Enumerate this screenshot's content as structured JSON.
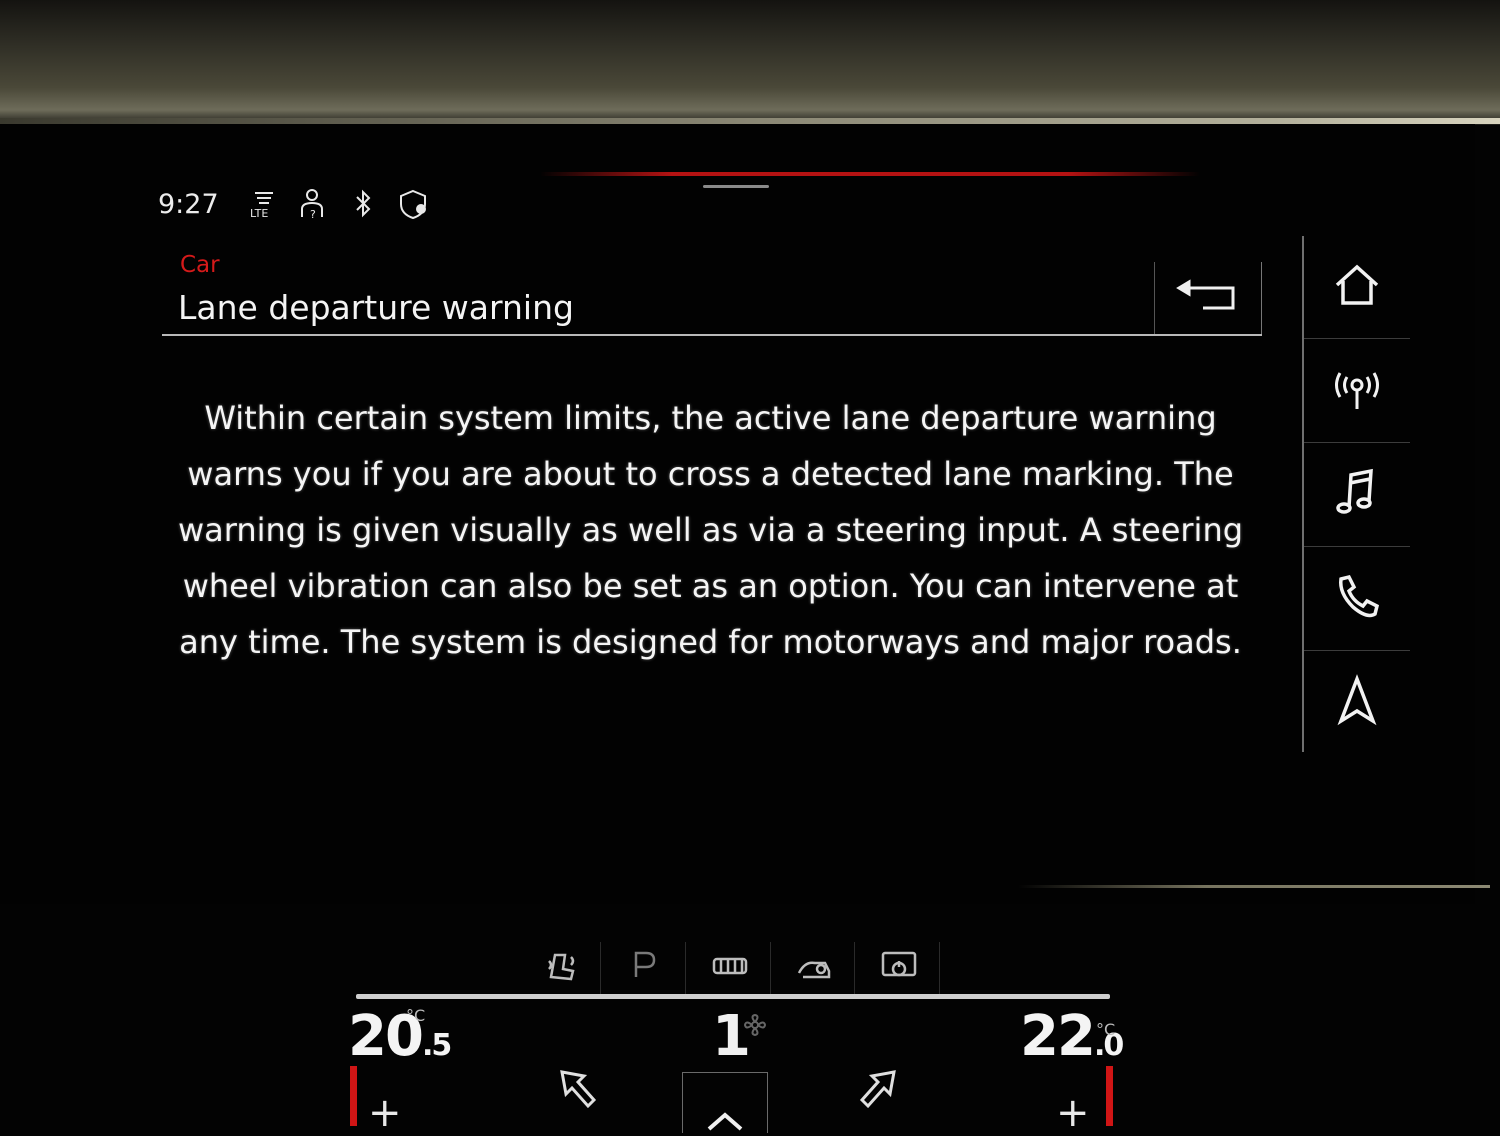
{
  "status_bar": {
    "time": "9:27",
    "icons": [
      "lte-signal-icon",
      "person-help-icon",
      "bluetooth-icon",
      "shield-location-icon"
    ]
  },
  "header": {
    "breadcrumb": "Car",
    "title": "Lane departure warning",
    "back_icon": "back-arrow-icon"
  },
  "main": {
    "description": "Within certain system limits, the active lane departure warning warns you if you are about to cross a detected lane marking. The warning is given visually as well as via a steering input. A steering wheel vibration can also be set as an option. You can intervene at any time. The system is designed for motorways and major roads."
  },
  "side_nav": {
    "items": [
      "home-icon",
      "radio-icon",
      "music-icon",
      "phone-icon",
      "navigation-icon"
    ]
  },
  "climate": {
    "left_temp": "20",
    "left_temp_decimal": ".5",
    "right_temp": "22",
    "right_temp_decimal": ".0",
    "temp_unit": "°C",
    "fan_level": "1",
    "plus_label": "+",
    "top_icons": [
      "seat-heat-icon",
      "parking-icon",
      "rear-defrost-icon",
      "car-air-icon",
      "display-power-icon"
    ],
    "colors": {
      "accent": "#d01515"
    }
  }
}
